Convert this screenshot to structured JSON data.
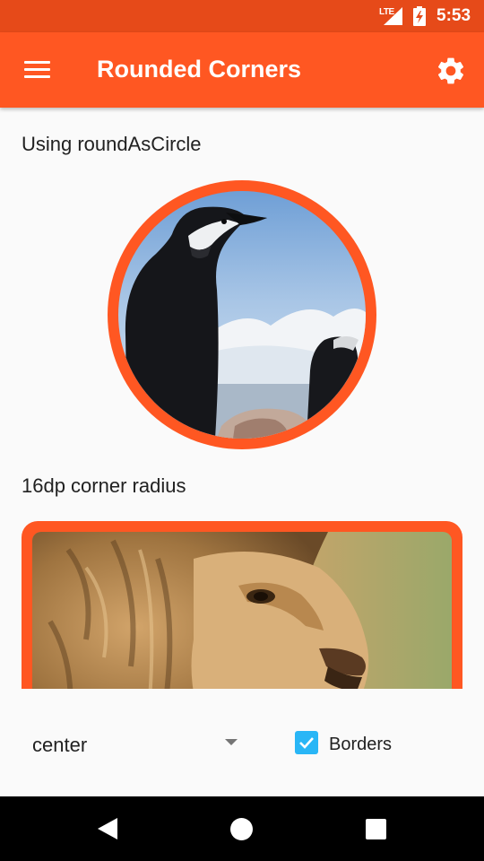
{
  "status_bar": {
    "network_label": "LTE",
    "time": "5:53",
    "icons": [
      "signal-icon",
      "battery-charging-icon"
    ]
  },
  "app_bar": {
    "title": "Rounded Corners",
    "icons": [
      "menu-icon",
      "settings-gear-icon"
    ]
  },
  "sections": {
    "circle_label": "Using roundAsCircle",
    "radius_label": "16dp corner radius"
  },
  "controls": {
    "scale_type_selected": "center",
    "borders_label": "Borders",
    "borders_checked": true
  },
  "nav_bar": {
    "icons": [
      "back-icon",
      "home-icon",
      "recents-icon"
    ]
  },
  "colors": {
    "status_bar": "#e64a19",
    "app_bar": "#ff5722",
    "border": "#ff5722",
    "checkbox": "#29b6f6",
    "background": "#fafafa"
  }
}
